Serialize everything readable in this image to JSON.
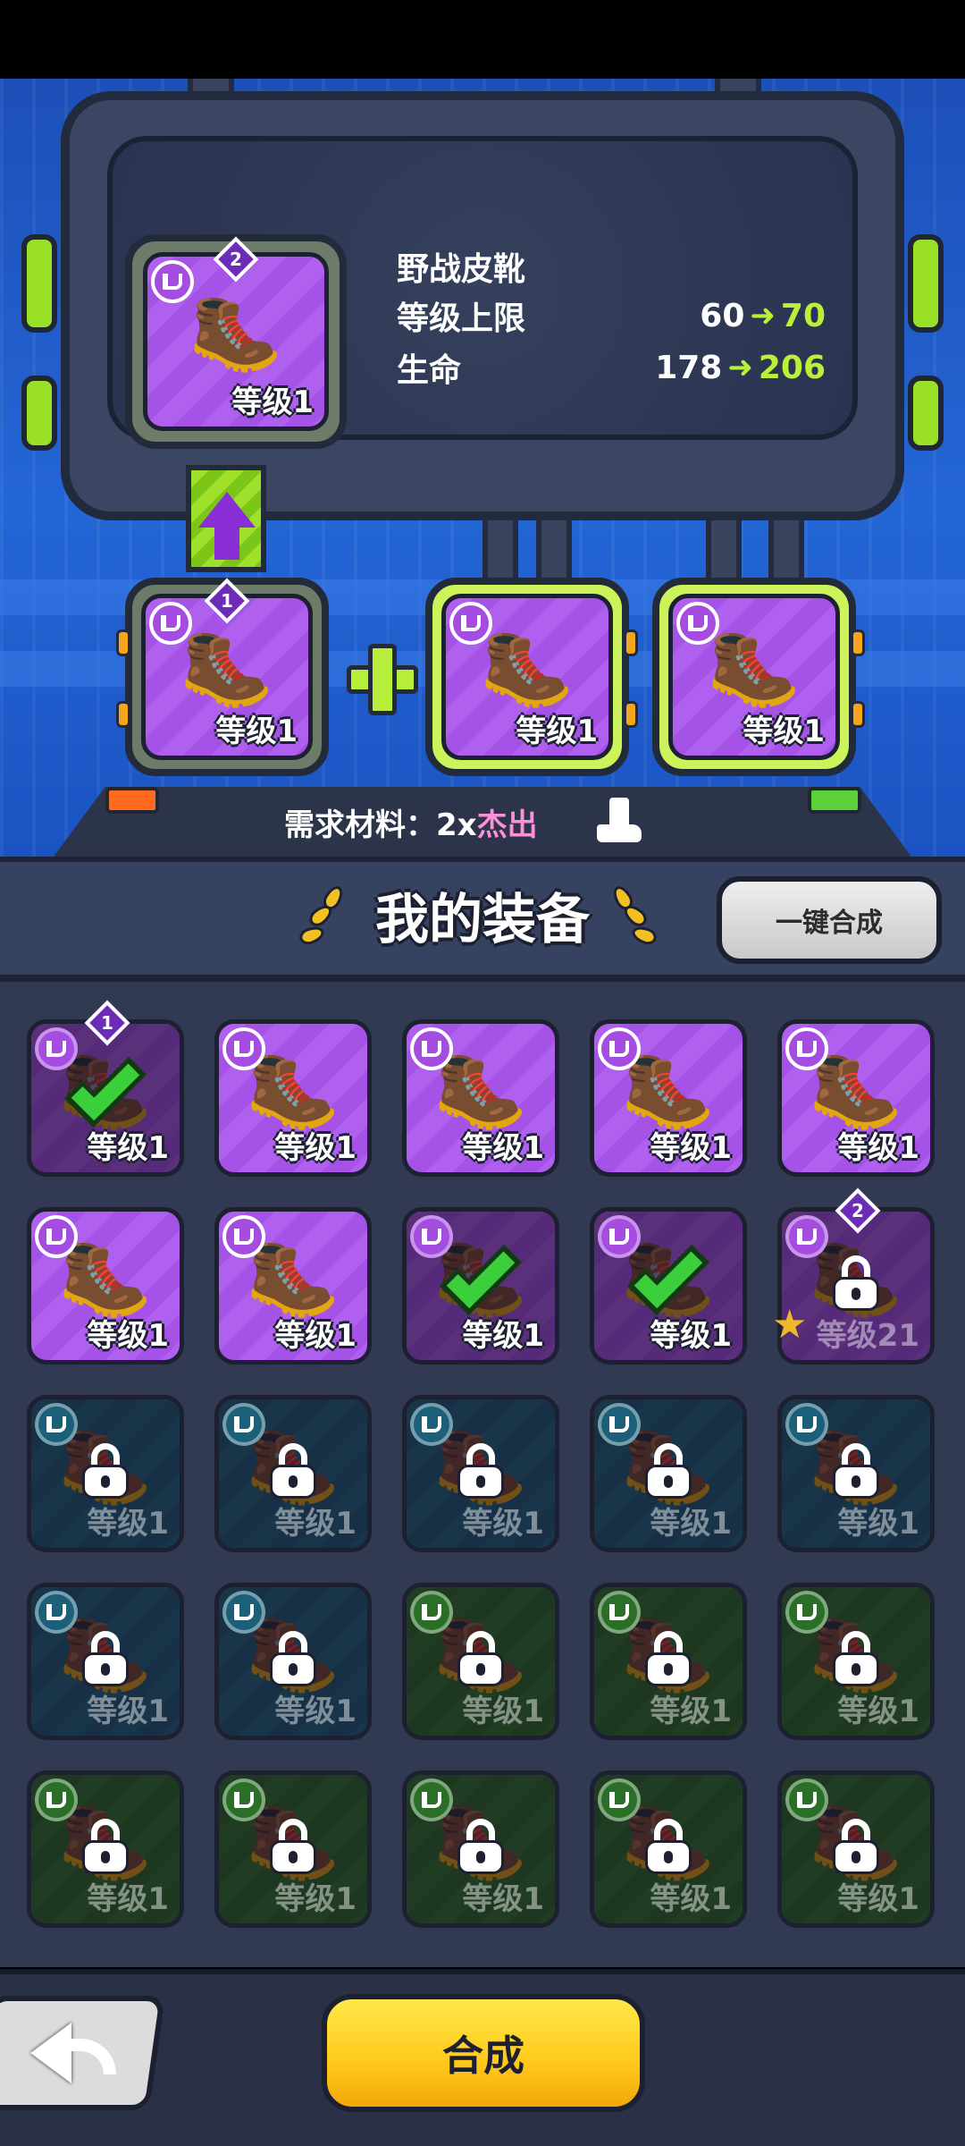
{
  "detail": {
    "item_name": "野战皮靴",
    "stats": [
      {
        "label": "等级上限",
        "from": "60",
        "to": "70"
      },
      {
        "label": "生命",
        "from": "178",
        "to": "206"
      }
    ],
    "main_item": {
      "level": "等级1",
      "tier": "2"
    },
    "materials": [
      {
        "level": "等级1",
        "tier": "1"
      },
      {
        "level": "等级1"
      },
      {
        "level": "等级1"
      }
    ],
    "requirement_prefix": "需求材料：2x",
    "requirement_quality": "杰出"
  },
  "inventory": {
    "title": "我的装备",
    "one_key_label": "一键合成",
    "rows": [
      [
        {
          "level": "等级1",
          "color": "purple",
          "state": "selected",
          "tier": "1"
        },
        {
          "level": "等级1",
          "color": "purple",
          "state": "normal"
        },
        {
          "level": "等级1",
          "color": "purple",
          "state": "normal"
        },
        {
          "level": "等级1",
          "color": "purple",
          "state": "normal"
        },
        {
          "level": "等级1",
          "color": "purple",
          "state": "normal"
        }
      ],
      [
        {
          "level": "等级1",
          "color": "purple",
          "state": "normal"
        },
        {
          "level": "等级1",
          "color": "purple",
          "state": "normal"
        },
        {
          "level": "等级1",
          "color": "purple",
          "state": "selected"
        },
        {
          "level": "等级1",
          "color": "purple",
          "state": "selected"
        },
        {
          "level": "等级21",
          "color": "purple",
          "state": "locked",
          "tier": "2",
          "star": "S"
        }
      ],
      [
        {
          "level": "等级1",
          "color": "teal",
          "state": "locked"
        },
        {
          "level": "等级1",
          "color": "teal",
          "state": "locked"
        },
        {
          "level": "等级1",
          "color": "teal",
          "state": "locked"
        },
        {
          "level": "等级1",
          "color": "teal",
          "state": "locked"
        },
        {
          "level": "等级1",
          "color": "teal",
          "state": "locked"
        }
      ],
      [
        {
          "level": "等级1",
          "color": "teal",
          "state": "locked"
        },
        {
          "level": "等级1",
          "color": "teal",
          "state": "locked"
        },
        {
          "level": "等级1",
          "color": "green",
          "state": "locked"
        },
        {
          "level": "等级1",
          "color": "green",
          "state": "locked"
        },
        {
          "level": "等级1",
          "color": "green",
          "state": "locked"
        }
      ],
      [
        {
          "level": "等级1",
          "color": "green",
          "state": "locked"
        },
        {
          "level": "等级1",
          "color": "green",
          "state": "locked"
        },
        {
          "level": "等级1",
          "color": "green",
          "state": "locked"
        },
        {
          "level": "等级1",
          "color": "green",
          "state": "locked"
        },
        {
          "level": "等级1",
          "color": "green",
          "state": "locked"
        }
      ]
    ]
  },
  "footer": {
    "synthesize_label": "合成"
  },
  "icons": {
    "item_icon": "boots-icon",
    "back": "back-arrow-icon",
    "upgrade": "up-arrow-icon",
    "lock": "lock-icon",
    "selected": "checkmark-icon"
  },
  "colors": {
    "purple": "#b060ee",
    "teal": "#1f6a82",
    "green": "#2f7a2c",
    "accent_green": "#b8f03a",
    "button_yellow": "#ffc81a"
  }
}
